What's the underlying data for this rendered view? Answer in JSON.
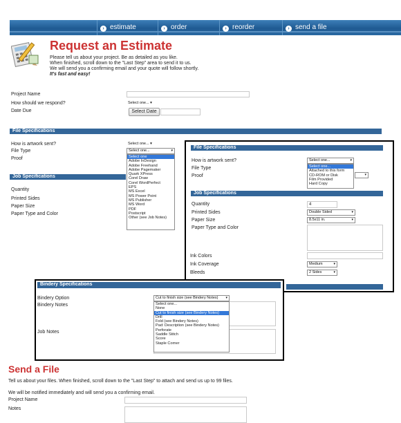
{
  "nav": {
    "tabs": [
      {
        "label": "estimate"
      },
      {
        "label": "order"
      },
      {
        "label": "reorder"
      },
      {
        "label": "send a file"
      }
    ]
  },
  "header": {
    "title": "Request an Estimate",
    "intro_lines": [
      "Please tell us about your project. Be as detailed as you like.",
      "When finished, scroll down to the \"Last Step\" area to send it to us.",
      "We will send you a confirming email and your quote will follow shortly."
    ],
    "tagline": "It's fast and easy!"
  },
  "project": {
    "name_label": "Project Name",
    "respond_label": "How should we respond?",
    "respond_value": "Select one...",
    "due_label": "Date Due",
    "select_date_button": "Select Date"
  },
  "file_specs": {
    "title": "File Specifications",
    "artwork_label": "How is artwork sent?",
    "artwork_value": "Select one...",
    "file_type_label": "File Type",
    "file_type_value": "Select one...",
    "proof_label": "Proof",
    "file_type_options": [
      "Select one",
      "Adobe InDesign",
      "Adobe Freehand",
      "Adobe Pagemaker",
      "Quark XPress",
      "Corel Draw",
      "Corel WordPerfect",
      "EPS",
      "MS Excel",
      "MS Power Point",
      "MS Publisher",
      "MS Word",
      "PDF",
      "Postscript",
      "Other (see Job Notes)"
    ]
  },
  "job_specs": {
    "title": "Job Specifications",
    "quantity_label": "Quantity",
    "printed_sides_label": "Printed Sides",
    "paper_size_label": "Paper Size",
    "paper_type_label": "Paper Type and Color"
  },
  "overlay_file": {
    "title": "File Specifications",
    "artwork_label": "How is artwork sent?",
    "artwork_value": "Select one...",
    "artwork_options": [
      "Select one...",
      "Attached to this form",
      "CD-ROM or Disk",
      "Film Provided",
      "Hard Copy"
    ],
    "file_type_label": "File Type",
    "proof_label": "Proof",
    "job_title": "Job Specifications",
    "quantity_label": "Quantity",
    "quantity_value": "4",
    "printed_sides_label": "Printed Sides",
    "printed_sides_value": "Double Sided",
    "paper_size_label": "Paper Size",
    "paper_size_value": "8.5x11 in.",
    "paper_type_label": "Paper Type and Color",
    "ink_colors_label": "Ink Colors",
    "ink_coverage_label": "Ink Coverage",
    "ink_coverage_value": "Medium",
    "bleeds_label": "Bleeds",
    "bleeds_value": "2 Sides"
  },
  "overlay_bindery": {
    "title": "Bindery Specifications",
    "option_label": "Bindery Option",
    "option_value": "Cut to finish size (see Bindery Notes)",
    "notes_label": "Bindery Notes",
    "job_notes_label": "Job Notes",
    "options": [
      "Select one...",
      "None",
      "Cut to finish size (see Bindery Notes)",
      "Drill",
      "Fold (see Bindery Notes)",
      "Pad: Description  (see Bindery Notes)",
      "Perforate",
      "Saddle Stitch",
      "Score",
      "Staple Corner"
    ]
  },
  "send_file": {
    "title": "Send a File",
    "intro": "Tell us about your files. When finished, scroll down to the \"Last Step\" to attach and send us up to 99 files.",
    "notify": "We will be notified immediately and will send you a confirming email.",
    "project_name_label": "Project Name",
    "notes_label": "Notes"
  },
  "colors": {
    "nav": "#2563a0",
    "section": "#336699",
    "title_red": "#cc3333",
    "highlight": "#3378d8"
  }
}
